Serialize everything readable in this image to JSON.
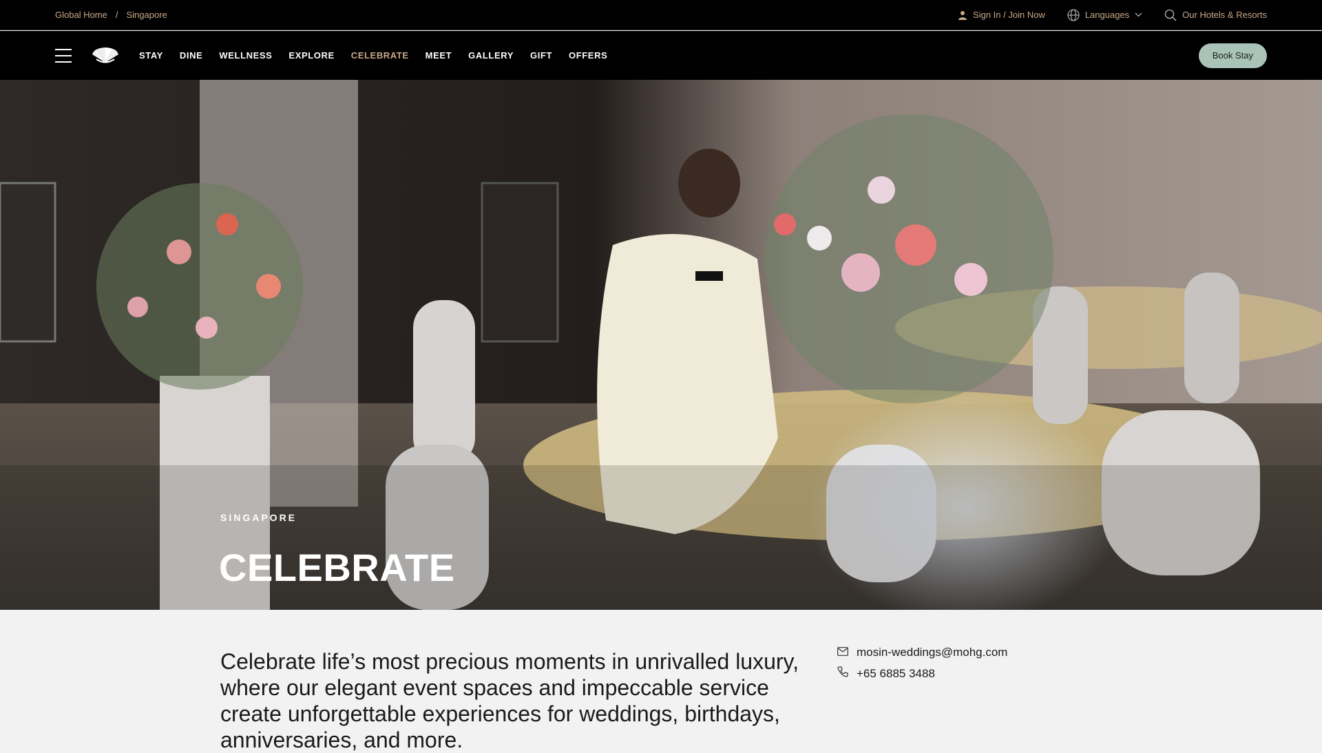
{
  "breadcrumb": {
    "items": [
      {
        "label": "Global Home"
      },
      {
        "label": "Singapore"
      }
    ],
    "separator": "/"
  },
  "utility": {
    "sign_in": "Sign In / Join Now",
    "languages": "Languages",
    "hotels": "Our Hotels & Resorts"
  },
  "nav": {
    "items": [
      {
        "label": "STAY"
      },
      {
        "label": "DINE"
      },
      {
        "label": "WELLNESS"
      },
      {
        "label": "EXPLORE"
      },
      {
        "label": "CELEBRATE"
      },
      {
        "label": "MEET"
      },
      {
        "label": "GALLERY"
      },
      {
        "label": "GIFT"
      },
      {
        "label": "OFFERS"
      }
    ],
    "active": "CELEBRATE",
    "book_label": "Book Stay"
  },
  "hero": {
    "eyebrow": "SINGAPORE",
    "title": "CELEBRATE"
  },
  "intro": {
    "text": "Celebrate life’s most precious moments in unrivalled luxury, where our elegant event spaces and impeccable service create unforgettable experiences for weddings, birthdays, anniversaries, and more.",
    "email": "mosin-weddings@mohg.com",
    "phone": "+65 6885 3488"
  },
  "colors": {
    "accent": "#c9a98a",
    "book_button": "#a9c3b8",
    "nav_bg": "#000000",
    "section_bg": "#f2f2f2"
  },
  "icons": [
    "hamburger-menu-icon",
    "fan-logo-icon",
    "user-icon",
    "globe-icon",
    "chevron-down-icon",
    "search-icon",
    "mail-icon",
    "phone-icon"
  ]
}
